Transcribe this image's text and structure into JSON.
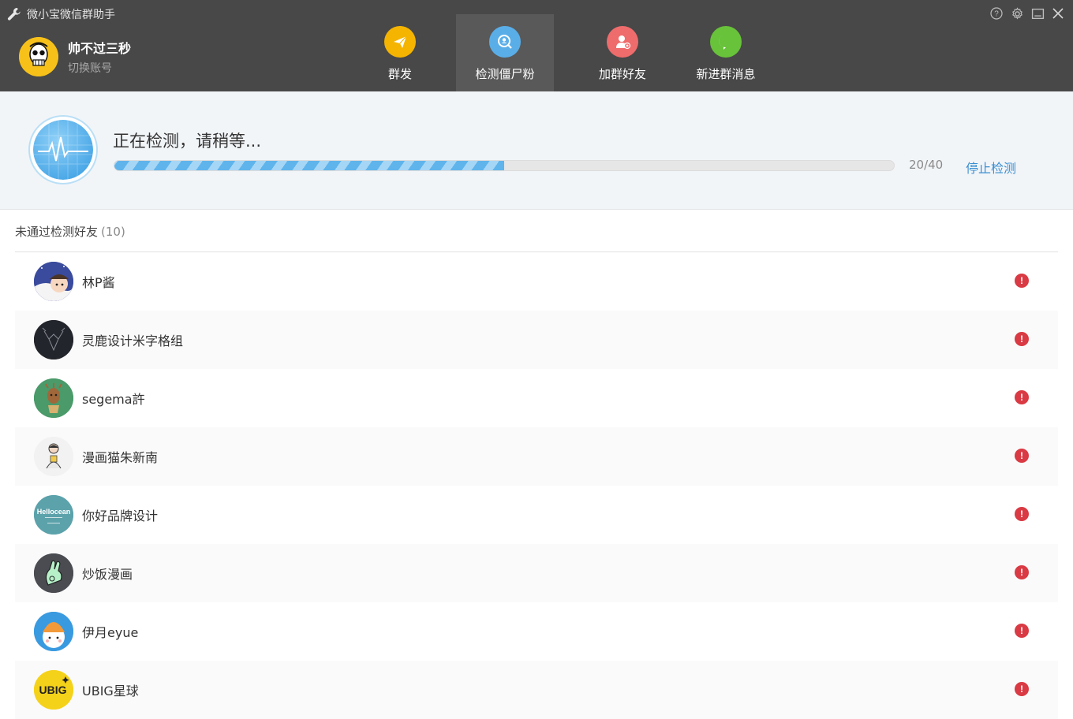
{
  "app": {
    "title": "微小宝微信群助手"
  },
  "account": {
    "name": "帅不过三秒",
    "switch_label": "切换账号"
  },
  "tabs": [
    {
      "label": "群发",
      "icon": "paper-plane-icon",
      "color": "#f4b400",
      "active": false
    },
    {
      "label": "检测僵尸粉",
      "icon": "search-user-icon",
      "color": "#5aaee8",
      "active": true
    },
    {
      "label": "加群好友",
      "icon": "add-user-icon",
      "color": "#ef6c6c",
      "active": false
    },
    {
      "label": "新进群消息",
      "icon": "chat-hi-icon",
      "color": "#68c23a",
      "active": false
    }
  ],
  "progress": {
    "status": "正在检测，请稍等...",
    "current": 20,
    "total": 40,
    "count_text": "20/40",
    "stop_label": "停止检测"
  },
  "section": {
    "title": "未通过检测好友",
    "count": "(10)"
  },
  "friends": [
    {
      "name": "林P酱"
    },
    {
      "name": "灵鹿设计米字格组"
    },
    {
      "name": "segema許"
    },
    {
      "name": "漫画猫朱新南"
    },
    {
      "name": "你好品牌设计"
    },
    {
      "name": "炒饭漫画"
    },
    {
      "name": "伊月eyue"
    },
    {
      "name": "UBIG星球"
    }
  ],
  "colors": {
    "header": "#484848",
    "accent": "#3a8fd1",
    "warning": "#d93a43"
  }
}
